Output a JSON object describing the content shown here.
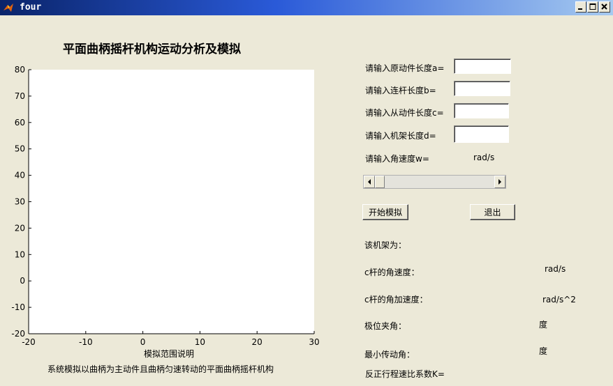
{
  "window": {
    "title": "four",
    "buttons": [
      "minimize",
      "maximize",
      "close"
    ]
  },
  "plot": {
    "title": "平面曲柄摇杆机构运动分析及模拟",
    "xlabel": "模拟范围说明",
    "caption": "系统模拟以曲柄为主动件且曲柄匀速转动的平面曲柄摇杆机构"
  },
  "chart_data": {
    "type": "line",
    "title": "平面曲柄摇杆机构运动分析及模拟",
    "xlabel": "模拟范围说明",
    "ylabel": "",
    "xlim": [
      -20,
      30
    ],
    "ylim": [
      -20,
      80
    ],
    "x_ticks": [
      "-20",
      "-10",
      "0",
      "10",
      "20",
      "30"
    ],
    "y_ticks": [
      "80",
      "70",
      "60",
      "50",
      "40",
      "30",
      "20",
      "10",
      "0",
      "-10",
      "-20"
    ],
    "series": [],
    "grid": false
  },
  "inputs": {
    "a_label": "请输入原动件长度a=",
    "a_value": "",
    "b_label": "请输入连杆长度b=",
    "b_value": "",
    "c_label": "请输入从动件长度c=",
    "c_value": "",
    "d_label": "请输入机架长度d=",
    "d_value": "",
    "w_label": "请输入角速度w=",
    "w_unit": "rad/s"
  },
  "slider": {
    "value_fraction": 0.0
  },
  "actions": {
    "start_label": "开始模拟",
    "exit_label": "退出"
  },
  "results": {
    "frame_label": "该机架为：",
    "c_angvel_label": "c杆的角速度：",
    "c_angvel_unit": "rad/s",
    "c_angacc_label": "c杆的角加速度：",
    "c_angacc_unit": "rad/s^2",
    "polar_angle_label": "极位夹角：",
    "polar_angle_unit": "度",
    "min_trans_label": "最小传动角：",
    "min_trans_unit": "度",
    "k_label": "反正行程速比系数K="
  },
  "colors": {
    "titlebar_start": "#0a246a",
    "titlebar_end": "#a6caf0",
    "background": "#ece9d8",
    "plot_area": "#ffffff"
  }
}
